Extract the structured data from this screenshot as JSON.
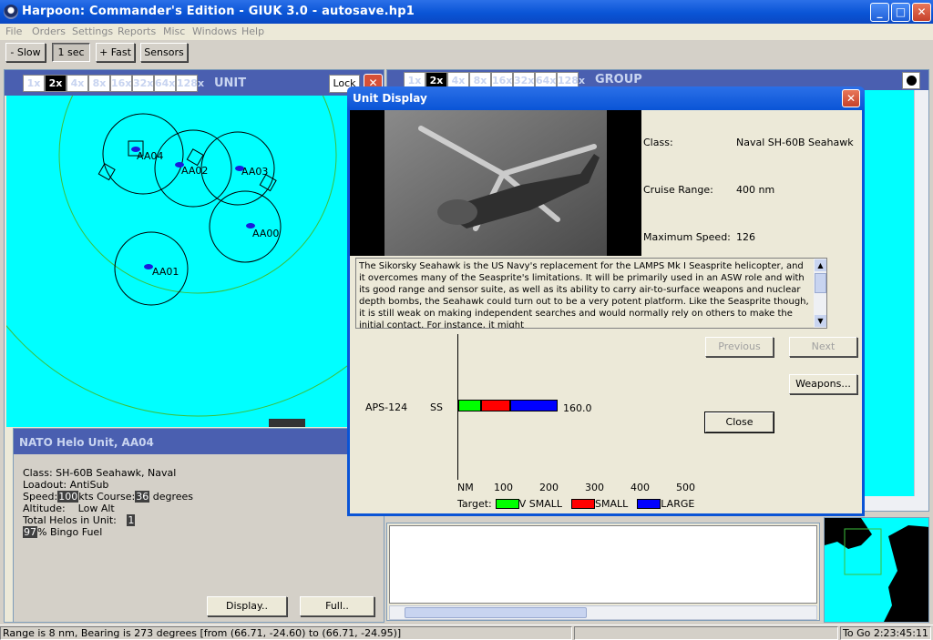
{
  "window": {
    "title": "Harpoon: Commander's Edition - GIUK 3.0 - autosave.hp1",
    "controls": [
      "_",
      "□",
      "✕"
    ]
  },
  "menu": [
    "File",
    "Orders",
    "Settings",
    "Reports",
    "Misc",
    "Windows",
    "Help"
  ],
  "toolbar": {
    "slow": "- Slow",
    "one_sec": "1 sec",
    "fast": "+ Fast",
    "sensors": "Sensors"
  },
  "unit_panel": {
    "zoom": [
      "1x",
      "2x",
      "4x",
      "8x",
      "16x",
      "32x",
      "64x",
      "128x"
    ],
    "active_zoom": "2x",
    "title": "UNIT",
    "lock": "Lock",
    "units": [
      "AA04",
      "AA02",
      "AA03",
      "AA00",
      "AA01"
    ]
  },
  "group_panel": {
    "zoom": [
      "1x",
      "2x",
      "4x",
      "8x",
      "16x",
      "32x",
      "64x",
      "128x"
    ],
    "active_zoom": "2x",
    "title": "GROUP"
  },
  "nato_panel": {
    "title": "NATO Helo Unit, AA04",
    "class": "Class: SH-60B Seahawk, Naval",
    "loadout": "Loadout: AntiSub",
    "speed_label": "Speed:",
    "speed": "100",
    "speed_unit": "kts",
    "course_label": "Course:",
    "course": "36",
    "course_unit": "degrees",
    "altitude": "Altitude:    Low Alt",
    "total_helos_label": "Total Helos in Unit:",
    "total_helos": "1",
    "bingo": "97",
    "bingo_label": "% Bingo Fuel",
    "display_btn": "Display..",
    "full_btn": "Full.."
  },
  "unit_display": {
    "title": "Unit Display",
    "class_label": "Class:",
    "class_value": "Naval  SH-60B Seahawk",
    "range_label": "Cruise Range:",
    "range_value": "400 nm",
    "speed_label": "Maximum Speed:",
    "speed_value": "126",
    "description": "The Sikorsky Seahawk is the US Navy's replacement for the LAMPS Mk I Seasprite helicopter, and it overcomes many of the Seasprite's limitations. It will be primarily used in an ASW role and with its good range and sensor suite, as well as its ability to carry air-to-surface weapons and nuclear depth bombs, the Seahawk could turn out to be a very potent platform.  Like the Seasprite though, it is still weak on making independent searches and would normally rely on others to make the initial contact. For instance, it might",
    "previous": "Previous",
    "next": "Next",
    "weapons": "Weapons...",
    "close": "Close"
  },
  "chart_data": {
    "type": "bar",
    "categories": [
      "APS-124"
    ],
    "sensor_type": "SS",
    "series": [
      {
        "name": "V SMALL",
        "values": [
          22
        ],
        "color": "#00ff00"
      },
      {
        "name": "SMALL",
        "values": [
          28
        ],
        "color": "#ff0000"
      },
      {
        "name": "LARGE",
        "values": [
          46
        ],
        "color": "#0000ff"
      }
    ],
    "value_label": "160.0",
    "xlabel_prefix": "NM",
    "ticks": [
      "100",
      "200",
      "300",
      "400",
      "500"
    ],
    "xlim": [
      0,
      500
    ],
    "legend_title": "Target:",
    "legend": [
      "V SMALL",
      "SMALL",
      "LARGE"
    ]
  },
  "status": {
    "range_text": "Range is 8 nm, Bearing is 273 degrees [from (66.71, -24.60) to (66.71, -24.95)]",
    "to_go": "To Go 2:23:45:11"
  },
  "colors": {
    "sea": "#00ffff",
    "window_blue": "#0a54d6",
    "panel_blue": "#4a5fb0"
  }
}
